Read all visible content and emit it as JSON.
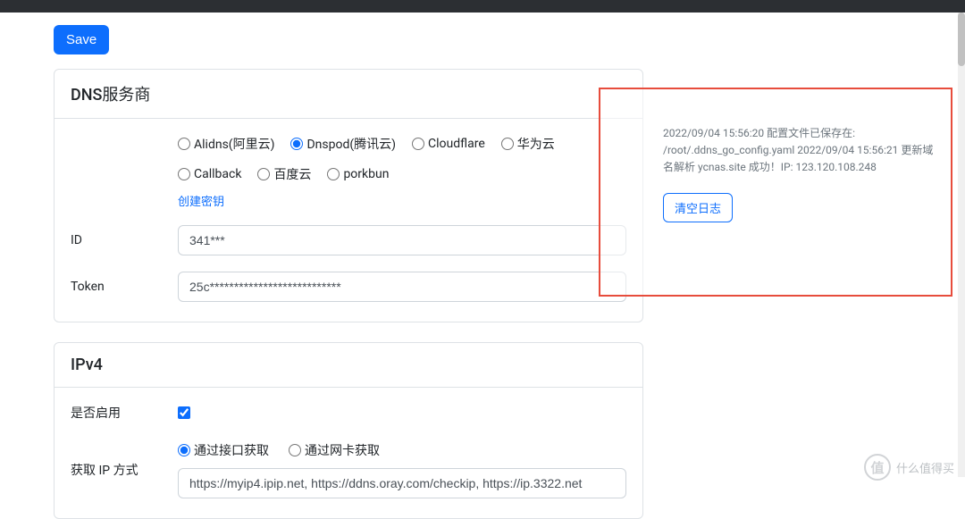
{
  "toolbar": {
    "save_label": "Save"
  },
  "dns_card": {
    "title": "DNS服务商",
    "providers": [
      {
        "label": "Alidns(阿里云)",
        "checked": false
      },
      {
        "label": "Dnspod(腾讯云)",
        "checked": true
      },
      {
        "label": "Cloudflare",
        "checked": false
      },
      {
        "label": "华为云",
        "checked": false
      },
      {
        "label": "Callback",
        "checked": false
      },
      {
        "label": "百度云",
        "checked": false
      },
      {
        "label": "porkbun",
        "checked": false
      }
    ],
    "create_key": "创建密钥",
    "id_label": "ID",
    "id_value": "341***",
    "token_label": "Token",
    "token_value": "25c***************************"
  },
  "ipv4_card": {
    "title": "IPv4",
    "enable_label": "是否启用",
    "enable_checked": true,
    "getip_label": "获取 IP 方式",
    "getip_options": [
      {
        "label": "通过接口获取",
        "checked": true
      },
      {
        "label": "通过网卡获取",
        "checked": false
      }
    ],
    "url_value": "https://myip4.ipip.net, https://ddns.oray.com/checkip, https://ip.3322.net"
  },
  "log": {
    "lines": "2022/09/04 15:56:20 配置文件已保存在: /root/.ddns_go_config.yaml\n2022/09/04 15:56:21 更新域名解析 ycnas.site 成功！IP: 123.120.108.248",
    "clear_label": "清空日志"
  },
  "watermark": {
    "badge": "值",
    "text": "什么值得买"
  }
}
